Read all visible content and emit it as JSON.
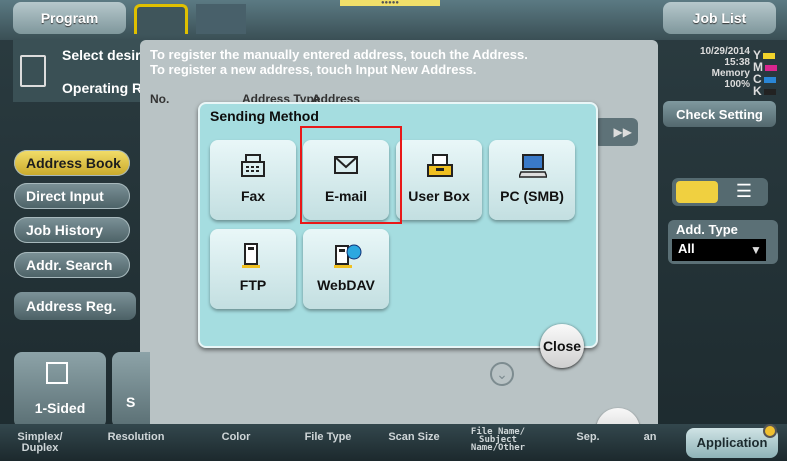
{
  "topbar": {
    "program_label": "Program",
    "joblist_label": "Job List",
    "center_mark": "●●●●●"
  },
  "status": {
    "date": "10/29/2014",
    "time": "15:38",
    "memory_label": "Memory",
    "memory_value": "100%",
    "toner": [
      {
        "letter": "Y",
        "color": "#f2d32b"
      },
      {
        "letter": "M",
        "color": "#d9268e"
      },
      {
        "letter": "C",
        "color": "#2a86d6"
      },
      {
        "letter": "K",
        "color": "#222222"
      }
    ],
    "check_setting_label": "Check Setting"
  },
  "info": {
    "select_text": "Select desire",
    "operating_text": "Operating R"
  },
  "sidebar": {
    "items": [
      {
        "label": "Address Book",
        "active": true
      },
      {
        "label": "Direct Input",
        "active": false
      },
      {
        "label": "Job History",
        "active": false
      },
      {
        "label": "Addr. Search",
        "active": false
      }
    ],
    "addr_reg_label": "Address Reg."
  },
  "sheet": {
    "message_line1": "To register the manually entered address, touch the Address.",
    "message_line2": "To register a new address, touch Input New Address.",
    "col_no": "No.",
    "col_type": "Address Type",
    "col_address": "Address",
    "close_label": "Close"
  },
  "right_panel": {
    "add_type_label": "Add. Type",
    "add_type_value": "All"
  },
  "modal": {
    "title": "Sending Method",
    "tiles": [
      {
        "label": "Fax",
        "icon": "fax-icon"
      },
      {
        "label": "E-mail",
        "icon": "email-icon",
        "selected": true
      },
      {
        "label": "User Box",
        "icon": "userbox-icon"
      },
      {
        "label": "PC (SMB)",
        "icon": "pc-icon"
      },
      {
        "label": "FTP",
        "icon": "ftp-icon"
      },
      {
        "label": "WebDAV",
        "icon": "webdav-icon"
      }
    ],
    "close_label": "Close"
  },
  "bottom": {
    "sided_label": "1-Sided",
    "res_partial": "S",
    "tabs": [
      {
        "line1": "Simplex/",
        "line2": "Duplex"
      },
      {
        "line1": "Resolution",
        "line2": ""
      },
      {
        "line1": "Color",
        "line2": ""
      },
      {
        "line1": "File Type",
        "line2": ""
      },
      {
        "line1": "Scan Size",
        "line2": ""
      },
      {
        "line1": "File Name/",
        "line2": "Subject",
        "line3": "Name/Other"
      },
      {
        "line1": "Sep.",
        "line2": ""
      },
      {
        "line1": "an",
        "line2": ""
      }
    ],
    "application_label": "Application"
  }
}
